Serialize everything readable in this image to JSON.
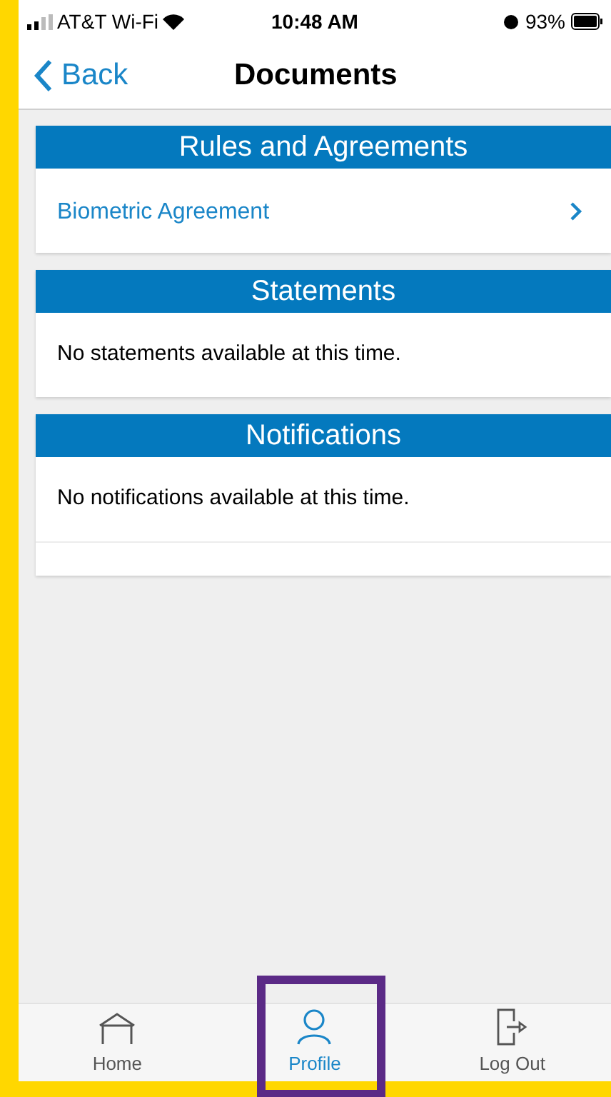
{
  "status_bar": {
    "carrier": "AT&T Wi-Fi",
    "time": "10:48 AM",
    "battery": "93%"
  },
  "nav": {
    "back": "Back",
    "title": "Documents"
  },
  "sections": [
    {
      "title": "Rules and Agreements",
      "rows": [
        {
          "kind": "link",
          "text": "Biometric Agreement"
        }
      ]
    },
    {
      "title": "Statements",
      "rows": [
        {
          "kind": "message",
          "text": "No statements available at this time."
        }
      ]
    },
    {
      "title": "Notifications",
      "rows": [
        {
          "kind": "message",
          "text": "No notifications available at this time."
        },
        {
          "kind": "blank"
        }
      ]
    }
  ],
  "tabs": [
    {
      "label": "Home",
      "kind": "home",
      "selected": false,
      "highlighted": false
    },
    {
      "label": "Profile",
      "kind": "profile",
      "selected": true,
      "highlighted": true
    },
    {
      "label": "Log Out",
      "kind": "logout",
      "selected": false,
      "highlighted": false
    }
  ]
}
